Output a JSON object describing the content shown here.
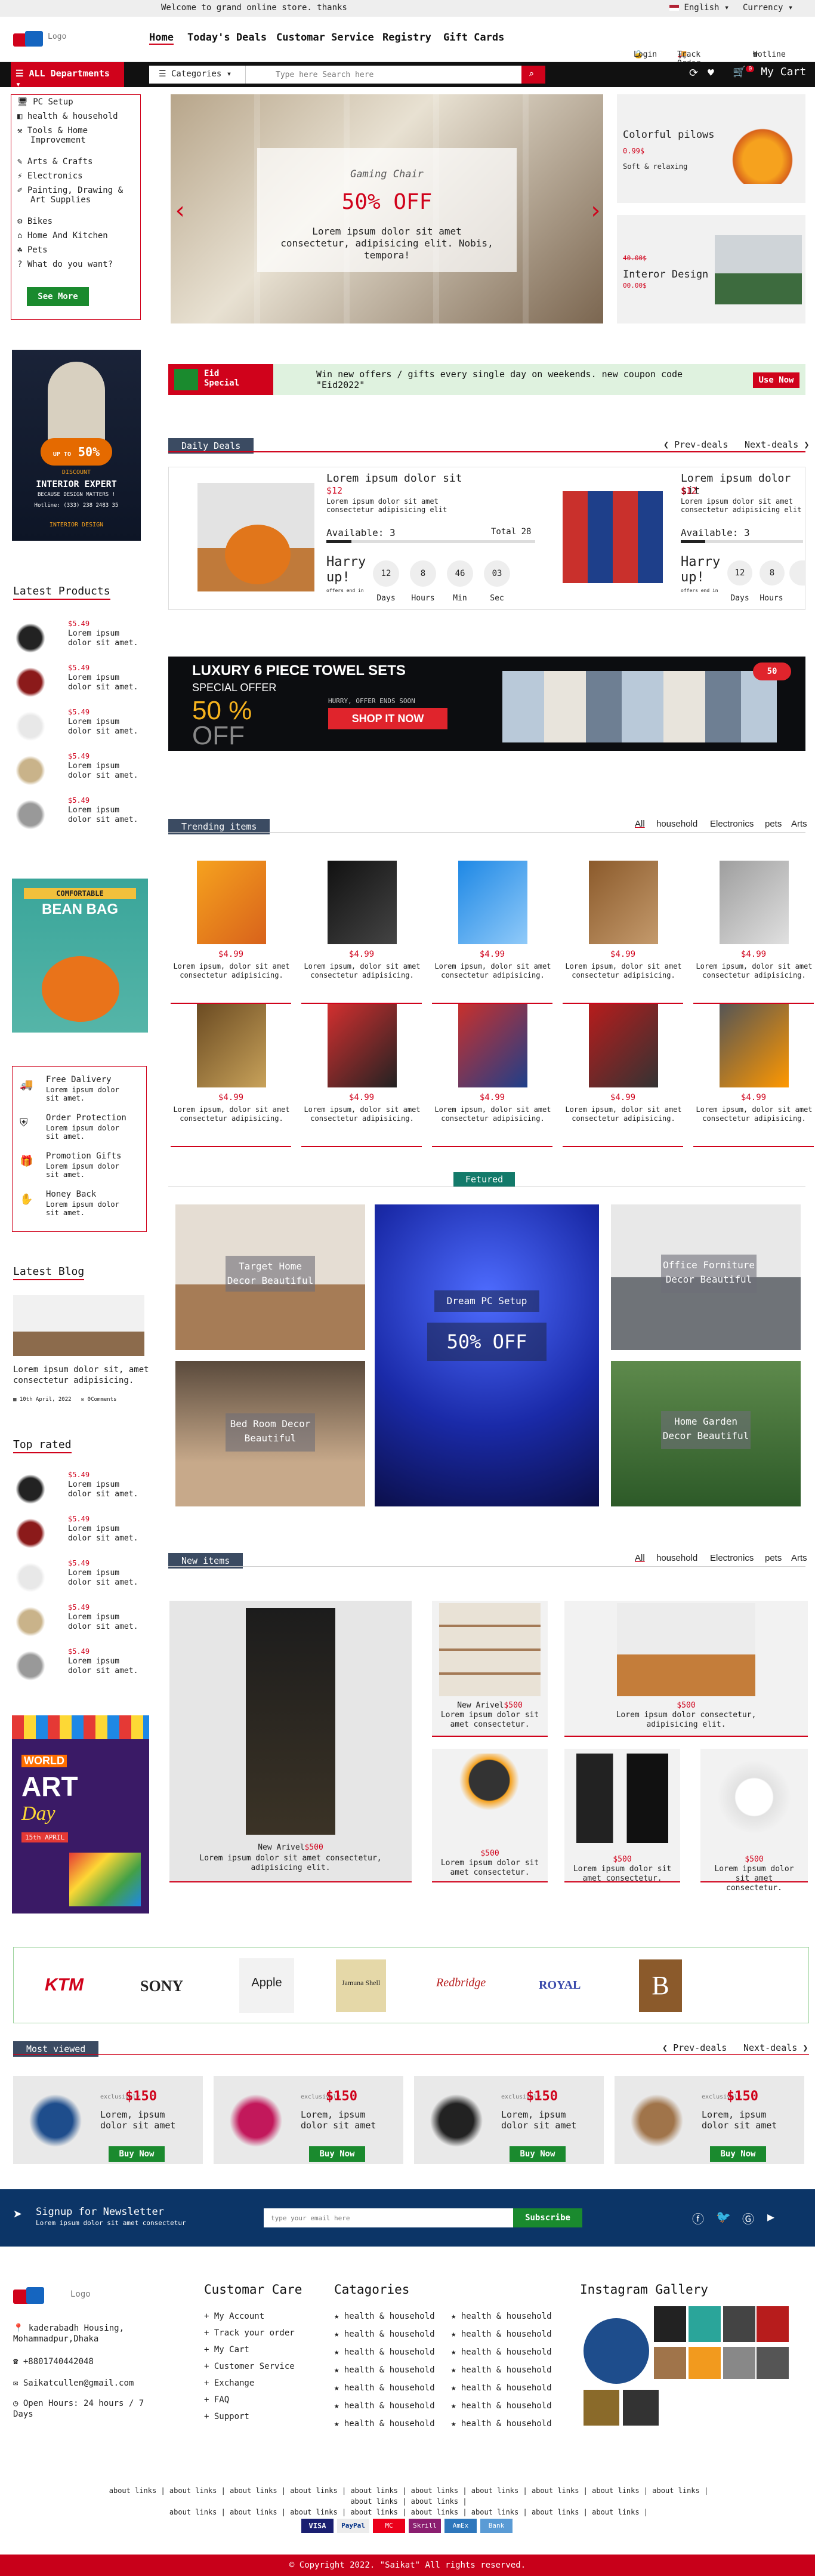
{
  "topbar": {
    "message": "Welcome to grand online store. thanks",
    "language": "English",
    "currency": "Currency"
  },
  "header": {
    "logo_text": "Logo",
    "nav": [
      "Home",
      "Today's Deals",
      "Customar Service",
      "Registry",
      "Gift Cards"
    ],
    "login": "Login",
    "track": "Track Order",
    "hotline": "Hotline"
  },
  "search": {
    "dept": "ALL Departments",
    "categories": "Categories",
    "placeholder": "Type here Search here",
    "cart": "My Cart",
    "cart_count": "0"
  },
  "sidebar": {
    "items": [
      "PC Setup",
      "health & household",
      "Tools & Home Improvement",
      "Arts & Crafts",
      "Electronics",
      "Painting, Drawing & Art Supplies",
      "Bikes",
      "Home And Kitchen",
      "Pets",
      "What do you want?"
    ],
    "see_more": "See More"
  },
  "hero": {
    "subtitle": "Gaming Chair",
    "headline": "50% OFF",
    "text": "Lorem ipsum dolor sit amet consectetur, adipisicing elit. Nobis, tempora!"
  },
  "promo1": {
    "title": "Colorful pilows",
    "price": "0.99$",
    "text": "Soft & relaxing"
  },
  "promo2": {
    "old": "40.00$",
    "title": "Interor Design",
    "price": "00.00$"
  },
  "left_ad": {
    "line1": "UP TO",
    "pct": "50%",
    "line2": "DISCOUNT",
    "line3": "INTERIOR EXPERT",
    "line4": "BECAUSE DESIGN MATTERS !",
    "phone": "Hotline: (333) 238 2483 35",
    "brand": "INTERIOR DESIGN"
  },
  "eid": {
    "badge_line1": "Eid",
    "badge_line2": "Special",
    "text": "Win new offers / gifts every single day on weekends. new coupon code \"Eid2022\"",
    "btn": "Use Now"
  },
  "daily": {
    "title": "Daily Deals",
    "prev": "Prev-deals",
    "next": "Next-deals",
    "item": {
      "title": "Lorem ipsum dolor sit",
      "price": "$12",
      "desc": "Lorem ipsum dolor sit amet consectetur adipisicing elit",
      "available": "Available: 3",
      "total": "Total 28",
      "hurry": "Harry up!",
      "offer_ends": "offers end in",
      "days": "12",
      "hours": "8",
      "min": "46",
      "sec": "03",
      "l_days": "Days",
      "l_hours": "Hours",
      "l_min": "Min",
      "l_sec": "Sec"
    }
  },
  "towel": {
    "line1": "LUXURY 6 PIECE TOWEL SETS",
    "line2": "SPECIAL OFFER",
    "pct": "50 %",
    "off": "OFF",
    "hurry": "HURRY, OFFER ENDS SOON",
    "shop": "SHOP IT NOW",
    "badge": "50"
  },
  "latest_products": {
    "title": "Latest Products",
    "items": [
      {
        "price": "$5.49",
        "desc": "Lorem ipsum dolor sit amet."
      },
      {
        "price": "$5.49",
        "desc": "Lorem ipsum dolor sit amet."
      },
      {
        "price": "$5.49",
        "desc": "Lorem ipsum dolor sit amet."
      },
      {
        "price": "$5.49",
        "desc": "Lorem ipsum dolor sit amet."
      },
      {
        "price": "$5.49",
        "desc": "Lorem ipsum dolor sit amet."
      }
    ]
  },
  "trending": {
    "title": "Trending items",
    "tabs": [
      "All",
      "household",
      "Electronics",
      "pets",
      "Arts"
    ],
    "price": "$4.99",
    "desc": "Lorem ipsum, dolor sit amet consectetur adipisicing."
  },
  "beanbag": {
    "line1": "COMFORTABLE",
    "line2": "BEAN BAG"
  },
  "services": [
    {
      "title": "Free Dalivery",
      "desc": "Lorem ipsum dolor sit amet."
    },
    {
      "title": "Order Protection",
      "desc": "Lorem ipsum dolor sit amet."
    },
    {
      "title": "Promotion Gifts",
      "desc": "Lorem ipsum dolor sit amet."
    },
    {
      "title": "Honey Back",
      "desc": "Lorem ipsum dolor sit amet."
    }
  ],
  "featured": {
    "title": "Fetured",
    "c1": "Target Home Decor Beautiful",
    "c2": "Dream PC Setup",
    "c2b": "50% OFF",
    "c3": "Office Forniture Decor Beautiful",
    "c4": "Bed Room Decor Beautiful",
    "c5": "Home Garden Decor Beautiful"
  },
  "blog": {
    "title": "Latest Blog",
    "text": "Lorem ipsum dolor sit, amet consectetur adipisicing.",
    "date": "10th April, 2022",
    "comments": "0Comments"
  },
  "top_rated": {
    "title": "Top rated",
    "items": [
      {
        "price": "$5.49",
        "desc": "Lorem ipsum dolor sit amet."
      },
      {
        "price": "$5.49",
        "desc": "Lorem ipsum dolor sit amet."
      },
      {
        "price": "$5.49",
        "desc": "Lorem ipsum dolor sit amet."
      },
      {
        "price": "$5.49",
        "desc": "Lorem ipsum dolor sit amet."
      },
      {
        "price": "$5.49",
        "desc": "Lorem ipsum dolor sit amet."
      }
    ]
  },
  "new_items": {
    "title": "New items",
    "tabs": [
      "All",
      "household",
      "Electronics",
      "pets",
      "Arts"
    ],
    "big_label": "New Arivel",
    "big_price": "$500",
    "big_desc": "Lorem ipsum dolor sit amet consectetur, adipisicing elit.",
    "c1_label": "New Arivel",
    "c1_price": "$500",
    "c1_desc": "Lorem ipsum dolor sit amet consectetur.",
    "c2_price": "$500",
    "c2_desc": "Lorem ipsum dolor consectetur, adipisicing elit.",
    "small_price": "$500",
    "small_desc": "Lorem ipsum dolor sit amet consectetur."
  },
  "art_day": {
    "line1": "WORLD",
    "line2": "ART",
    "line3": "Day",
    "date": "15th APRIL"
  },
  "brands": [
    "KTM",
    "SONY",
    "Apple",
    "Jamuna Shell",
    "Redbridge",
    "ROYAL",
    "B"
  ],
  "most_viewed": {
    "title": "Most viewed",
    "prev": "Prev-deals",
    "next": "Next-deals",
    "excl": "exclusively",
    "price": "$150",
    "desc": "Lorem, ipsum dolor sit amet",
    "btn": "Buy Now"
  },
  "newsletter": {
    "title": "Signup for Newsletter",
    "sub": "Lorem ipsum dolor sit amet consectetur",
    "placeholder": "type your email here",
    "btn": "Subscribe"
  },
  "footer": {
    "logo": "Logo",
    "address": "kaderabadh Housing, Mohammadpur,Dhaka",
    "phone": "+8801740442048",
    "email": "Saikatcullen@gmail.com",
    "hours": "Open Hours: 24 hours / 7 Days",
    "care_title": "Customar Care",
    "care": [
      "My Account",
      "Track your order",
      "My Cart",
      "Customer Service",
      "Exchange",
      "FAQ",
      "Support"
    ],
    "cat_title": "Catagories",
    "cat_item": "health & household",
    "gallery_title": "Instagram Gallery",
    "about": "about links",
    "copyright": "© Copyright 2022. \"Saikat\" All rights reserved.",
    "cards": [
      "VISA",
      "PayPal",
      "MC",
      "Skrill",
      "AmEx",
      "Bank"
    ]
  },
  "colors": {
    "accent": "#d0021b",
    "green": "#1a8a2e",
    "navy": "#0c3567",
    "slate": "#3b4b62"
  }
}
